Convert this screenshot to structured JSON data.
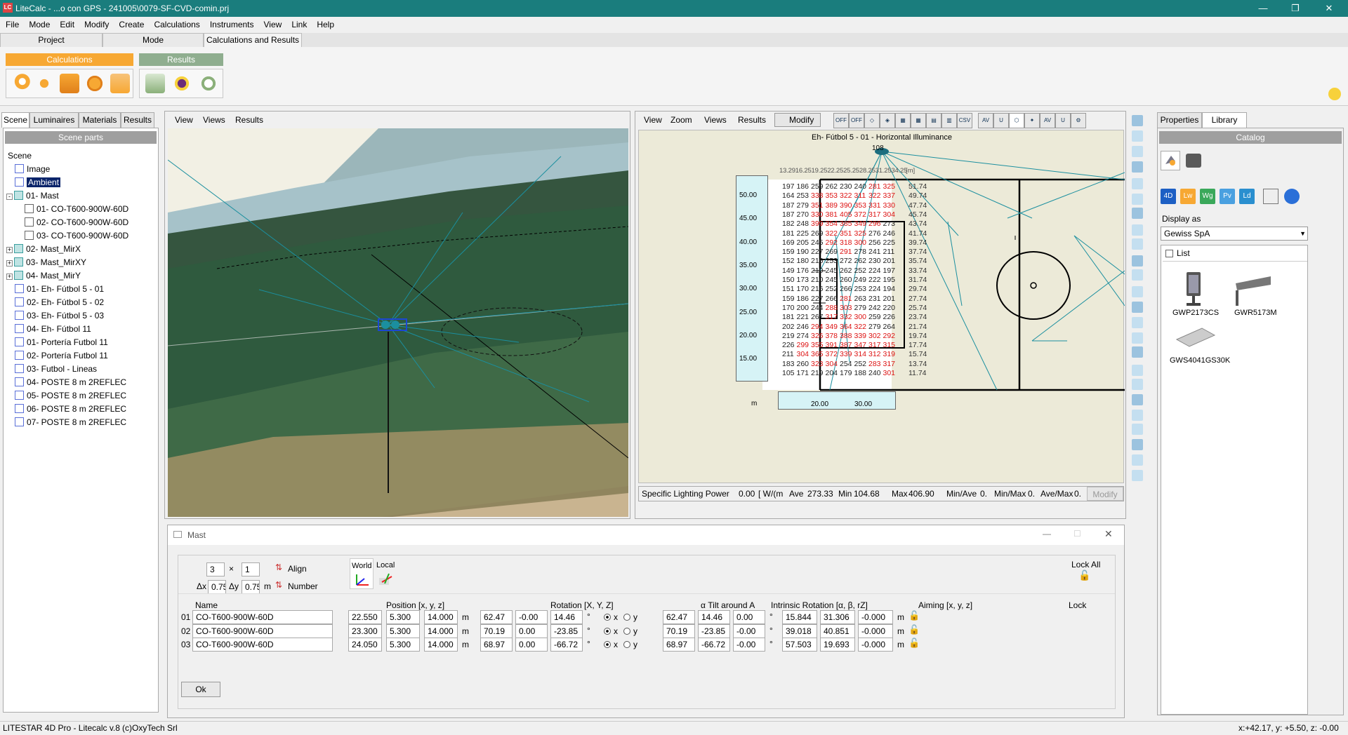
{
  "window": {
    "title": "LiteCalc - ...o con GPS - 241005\\0079-SF-CVD-comin.prj",
    "logo": "LC"
  },
  "menu": [
    "File",
    "Mode",
    "Edit",
    "Modify",
    "Create",
    "Calculations",
    "Instruments",
    "View",
    "Link",
    "Help"
  ],
  "mode_tabs": [
    "Project",
    "Mode",
    "Calculations and Results"
  ],
  "ribbon": {
    "group1": "Calculations",
    "group2": "Results",
    "group1_color": "#f7a833",
    "group2_color": "#8fae8f"
  },
  "left_tabs": [
    "Scene",
    "Luminaires",
    "Materials",
    "Results"
  ],
  "scene_parts_header": "Scene parts",
  "tree": {
    "root": "Scene",
    "items": [
      {
        "label": "Image",
        "level": 1
      },
      {
        "label": "Ambient",
        "level": 1,
        "selected": true
      },
      {
        "label": "01- Mast",
        "level": 0,
        "expand": "-"
      },
      {
        "label": "01- CO-T600-900W-60D",
        "level": 2
      },
      {
        "label": "02- CO-T600-900W-60D",
        "level": 2
      },
      {
        "label": "03- CO-T600-900W-60D",
        "level": 2
      },
      {
        "label": "02- Mast_MirX",
        "level": 0,
        "expand": "+"
      },
      {
        "label": "03- Mast_MirXY",
        "level": 0,
        "expand": "+"
      },
      {
        "label": "04- Mast_MirY",
        "level": 0,
        "expand": "+"
      },
      {
        "label": "01- Eh- Fútbol 5 - 01",
        "level": 1
      },
      {
        "label": "02- Eh- Fútbol 5 - 02",
        "level": 1
      },
      {
        "label": "03- Eh- Fútbol 5 - 03",
        "level": 1
      },
      {
        "label": "04- Eh- Fútbol 11",
        "level": 1
      },
      {
        "label": "01- Portería Futbol 11",
        "level": 1
      },
      {
        "label": "02- Portería Futbol 11",
        "level": 1
      },
      {
        "label": "03- Futbol - Lineas",
        "level": 1
      },
      {
        "label": "04- POSTE 8 m 2REFLEC",
        "level": 1
      },
      {
        "label": "05- POSTE 8 m 2REFLEC",
        "level": 1
      },
      {
        "label": "06- POSTE 8 m 2REFLEC",
        "level": 1
      },
      {
        "label": "07- POSTE 8 m 2REFLEC",
        "level": 1
      }
    ]
  },
  "view3d": {
    "menu": [
      "View",
      "Views",
      "Results"
    ]
  },
  "view2d": {
    "menu": [
      "View",
      "Zoom",
      "Views",
      "Results"
    ],
    "modify_label": "Modify",
    "title": "Eh- Fútbol 5 - 01 - Horizontal Illuminance",
    "unit_m": "[m]",
    "m_label": "m",
    "top_ruler": "13.2916.2519.2522.2525.2528.2531.2534.25",
    "top_marker": "108",
    "y_axis": [
      "50.00",
      "45.00",
      "40.00",
      "35.00",
      "30.00",
      "25.00",
      "20.00",
      "15.00"
    ],
    "x_axis": [
      "20.00",
      "30.00"
    ],
    "row_labels": [
      "51.74",
      "49.74",
      "47.74",
      "45.74",
      "43.74",
      "41.74",
      "39.74",
      "37.74",
      "35.74",
      "33.74",
      "31.74",
      "29.74",
      "27.74",
      "25.74",
      "23.74",
      "21.74",
      "19.74",
      "17.74",
      "15.74",
      "13.74",
      "11.74"
    ],
    "grid": [
      [
        "197",
        "186",
        "259",
        "262",
        "230",
        "240",
        "281",
        "325"
      ],
      [
        "164",
        "253",
        "338",
        "353",
        "322",
        "311",
        "322",
        "337"
      ],
      [
        "187",
        "279",
        "351",
        "389",
        "390",
        "353",
        "331",
        "330"
      ],
      [
        "187",
        "270",
        "330",
        "381",
        "405",
        "372",
        "317",
        "304"
      ],
      [
        "182",
        "248",
        "399",
        "354",
        "385",
        "349",
        "296",
        "273"
      ],
      [
        "181",
        "225",
        "269",
        "322",
        "351",
        "325",
        "276",
        "246"
      ],
      [
        "169",
        "205",
        "245",
        "292",
        "318",
        "300",
        "256",
        "225"
      ],
      [
        "159",
        "190",
        "227",
        "269",
        "291",
        "278",
        "241",
        "211"
      ],
      [
        "152",
        "180",
        "216",
        "253",
        "272",
        "262",
        "230",
        "201"
      ],
      [
        "149",
        "176",
        "210",
        "245",
        "262",
        "252",
        "224",
        "197"
      ],
      [
        "150",
        "173",
        "210",
        "245",
        "260",
        "249",
        "222",
        "195"
      ],
      [
        "151",
        "170",
        "216",
        "252",
        "266",
        "253",
        "224",
        "194"
      ],
      [
        "159",
        "186",
        "227",
        "266",
        "281",
        "263",
        "231",
        "201"
      ],
      [
        "170",
        "200",
        "244",
        "288",
        "303",
        "279",
        "242",
        "220"
      ],
      [
        "181",
        "221",
        "267",
        "317",
        "332",
        "300",
        "259",
        "226"
      ],
      [
        "202",
        "246",
        "294",
        "349",
        "364",
        "322",
        "279",
        "264"
      ],
      [
        "219",
        "274",
        "326",
        "378",
        "388",
        "339",
        "302",
        "292"
      ],
      [
        "226",
        "299",
        "355",
        "391",
        "387",
        "347",
        "317",
        "315"
      ],
      [
        "211",
        "304",
        "365",
        "372",
        "339",
        "314",
        "312",
        "319"
      ],
      [
        "183",
        "260",
        "323",
        "304",
        "254",
        "252",
        "283",
        "317"
      ],
      [
        "105",
        "171",
        "219",
        "204",
        "179",
        "188",
        "240",
        "301"
      ]
    ],
    "stats": {
      "slp_label": "Specific Lighting Power",
      "slp_value": "0.00",
      "slp_unit": "[ W/(m",
      "ave_label": "Ave",
      "ave_value": "273.33",
      "min_label": "Min",
      "min_value": "104.68",
      "max_label": "Max",
      "max_value": "406.90",
      "minave_label": "Min/Ave",
      "minave_value": "0.",
      "minmax_label": "Min/Max",
      "minmax_value": "0.",
      "avemax_label": "Ave/Max",
      "avemax_value": "0.",
      "modify_label": "Modify"
    }
  },
  "mast_panel": {
    "title": "Mast",
    "count_x": "3",
    "count_y": "1",
    "times": "×",
    "dx_label": "Δx",
    "dx": "0.75",
    "dy_label": "Δy",
    "dy": "0.75",
    "unit": "m",
    "align_label": "Align",
    "number_label": "Number",
    "world_label": "World",
    "local_label": "Local",
    "lock_all_label": "Lock All",
    "headers": {
      "name": "Name",
      "position": "Position  [x, y, z]",
      "rotation": "Rotation  [X, Y, Z]",
      "tilt": "α Tilt around A",
      "intrinsic": "Intrinsic Rotation  [α, β, rZ]",
      "aiming": "Aiming  [x, y, z]",
      "lock": "Lock"
    },
    "rows": [
      {
        "idx": "01",
        "name": "CO-T600-900W-60D",
        "pos": [
          "22.550",
          "5.300",
          "14.000"
        ],
        "rot": [
          "62.47",
          "-0.00",
          "14.46"
        ],
        "intr": [
          "62.47",
          "14.46",
          "0.00"
        ],
        "aim": [
          "15.844",
          "31.306",
          "-0.000"
        ]
      },
      {
        "idx": "02",
        "name": "CO-T600-900W-60D",
        "pos": [
          "23.300",
          "5.300",
          "14.000"
        ],
        "rot": [
          "70.19",
          "0.00",
          "-23.85"
        ],
        "intr": [
          "70.19",
          "-23.85",
          "-0.00"
        ],
        "aim": [
          "39.018",
          "40.851",
          "-0.000"
        ]
      },
      {
        "idx": "03",
        "name": "CO-T600-900W-60D",
        "pos": [
          "24.050",
          "5.300",
          "14.000"
        ],
        "rot": [
          "68.97",
          "0.00",
          "-66.72"
        ],
        "intr": [
          "68.97",
          "-66.72",
          "-0.00"
        ],
        "aim": [
          "57.503",
          "19.693",
          "-0.000"
        ]
      }
    ],
    "unit_m": "m",
    "unit_deg": "°",
    "x_label": "x",
    "y_label": "y",
    "ok_label": "Ok"
  },
  "right_tabs": [
    "Properties",
    "Library"
  ],
  "catalog": {
    "header": "Catalog",
    "brand_icons": [
      "4D",
      "Lw",
      "Wg",
      "Pv",
      "Ld"
    ],
    "display_as_label": "Display as",
    "display_as_value": "Gewiss SpA",
    "list_label": "List",
    "products": [
      "GWP2173CS",
      "GWR5173M",
      "GWS4041GS30K"
    ]
  },
  "status": {
    "left": "LITESTAR 4D Pro - Litecalc v.8",
    "center": "(c)OxyTech Srl",
    "right": "x:+42.17, y: +5.50, z: -0.00"
  }
}
